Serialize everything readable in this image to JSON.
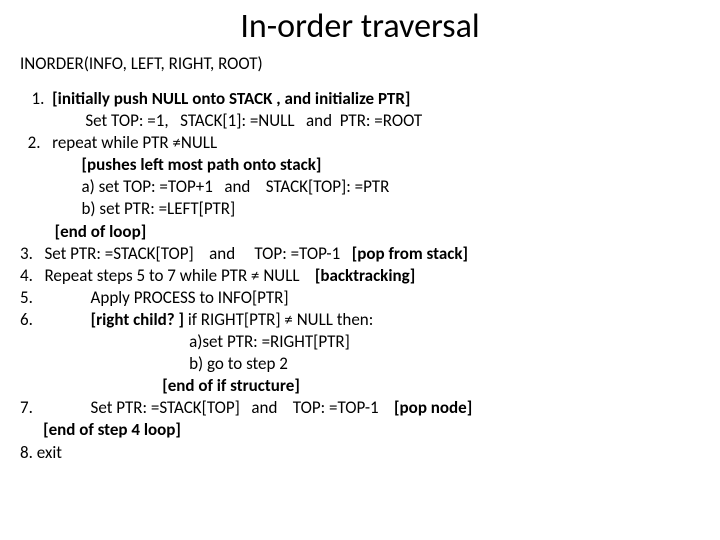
{
  "title": "In-order traversal",
  "signature": "INORDER(INFO, LEFT, RIGHT, ROOT)",
  "lines": {
    "l1a": "   1.  ",
    "l1b": "[initially push NULL onto STACK , and initialize PTR]",
    "l2": "                 Set TOP: =1,   STACK[1]: =NULL   and  PTR: =ROOT",
    "l3": "  2.   repeat while PTR ≠NULL",
    "l4": "                ",
    "l4b": "[pushes left most path onto stack]",
    "l5": "                a) set TOP: =TOP+1   and    STACK[TOP]: =PTR",
    "l6": "                b) set PTR: =LEFT[PTR]",
    "l7": "         ",
    "l7b": "[end of loop]",
    "l8a": "3.   Set PTR: =STACK[TOP]    and     TOP: =TOP-1   ",
    "l8b": "[pop from stack]",
    "l9a": "4.   Repeat steps 5 to 7 while PTR ≠ NULL    ",
    "l9b": "[backtracking]",
    "l10": "5.               Apply PROCESS to INFO[PTR]",
    "l11a": "6.               ",
    "l11b": "[right child? ]",
    "l11c": " if RIGHT[PTR] ≠ NULL then:",
    "l12": "                                            a)set PTR: =RIGHT[PTR]",
    "l13": "                                            b) go to step 2",
    "l14": "                                     ",
    "l14b": "[end of if structure]",
    "l15a": "7.               Set PTR: =STACK[TOP]   and    TOP: =TOP-1    ",
    "l15b": "[pop node]",
    "l16": "      ",
    "l16b": "[end of step 4 loop]",
    "l17": "8. exit"
  }
}
